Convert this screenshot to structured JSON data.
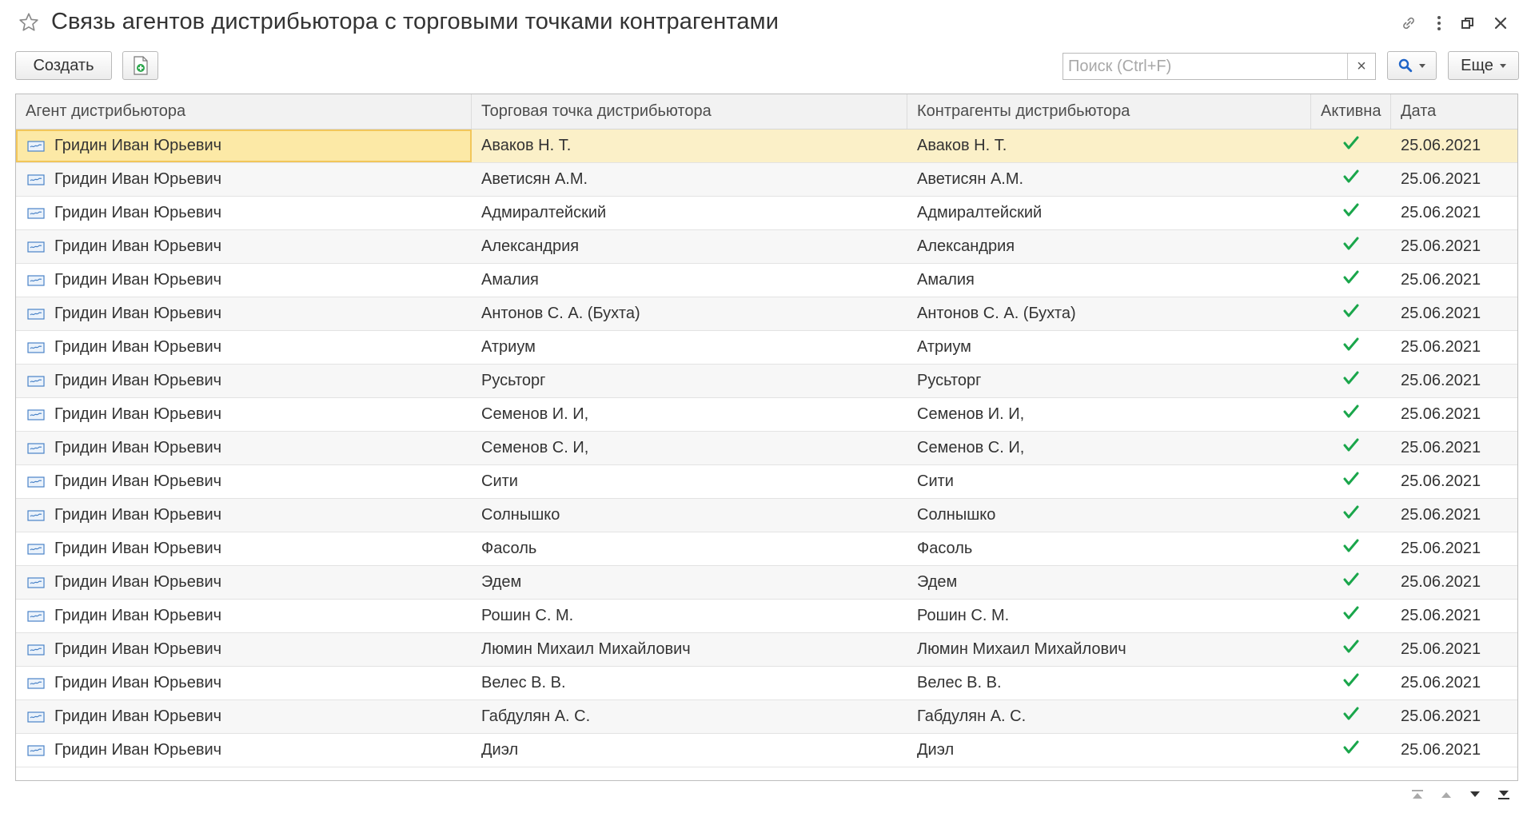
{
  "window": {
    "title": "Связь агентов дистрибьютора с торговыми точками контрагентами",
    "icons": [
      "star-icon",
      "link-icon",
      "more-vert-icon",
      "restore-icon",
      "close-icon"
    ]
  },
  "toolbar": {
    "create_label": "Создать",
    "copy_icon": "add-document-icon",
    "search_placeholder": "Поиск (Ctrl+F)",
    "search_value": "",
    "clear_label": "×",
    "more_label": "Еще"
  },
  "table": {
    "columns": [
      "Агент дистрибьютора",
      "Торговая точка дистрибьютора",
      "Контрагенты дистрибьютора",
      "Активна",
      "Дата"
    ],
    "rows": [
      {
        "agent": "Гридин Иван Юрьевич",
        "point": "Аваков Н. Т.",
        "contractor": "Аваков Н. Т.",
        "active": true,
        "date": "25.06.2021"
      },
      {
        "agent": "Гридин Иван Юрьевич",
        "point": "Аветисян А.М.",
        "contractor": "Аветисян А.М.",
        "active": true,
        "date": "25.06.2021"
      },
      {
        "agent": "Гридин Иван Юрьевич",
        "point": "Адмиралтейский",
        "contractor": "Адмиралтейский",
        "active": true,
        "date": "25.06.2021"
      },
      {
        "agent": "Гридин Иван Юрьевич",
        "point": "Александрия",
        "contractor": "Александрия",
        "active": true,
        "date": "25.06.2021"
      },
      {
        "agent": "Гридин Иван Юрьевич",
        "point": "Амалия",
        "contractor": "Амалия",
        "active": true,
        "date": "25.06.2021"
      },
      {
        "agent": "Гридин Иван Юрьевич",
        "point": "Антонов С. А. (Бухта)",
        "contractor": "Антонов С. А. (Бухта)",
        "active": true,
        "date": "25.06.2021"
      },
      {
        "agent": "Гридин Иван Юрьевич",
        "point": "Атриум",
        "contractor": "Атриум",
        "active": true,
        "date": "25.06.2021"
      },
      {
        "agent": "Гридин Иван Юрьевич",
        "point": "Русьторг",
        "contractor": "Русьторг",
        "active": true,
        "date": "25.06.2021"
      },
      {
        "agent": "Гридин Иван Юрьевич",
        "point": "Семенов И. И,",
        "contractor": "Семенов И. И,",
        "active": true,
        "date": "25.06.2021"
      },
      {
        "agent": "Гридин Иван Юрьевич",
        "point": "Семенов С. И,",
        "contractor": "Семенов С. И,",
        "active": true,
        "date": "25.06.2021"
      },
      {
        "agent": "Гридин Иван Юрьевич",
        "point": "Сити",
        "contractor": "Сити",
        "active": true,
        "date": "25.06.2021"
      },
      {
        "agent": "Гридин Иван Юрьевич",
        "point": "Солнышко",
        "contractor": "Солнышко",
        "active": true,
        "date": "25.06.2021"
      },
      {
        "agent": "Гридин Иван Юрьевич",
        "point": "Фасоль",
        "contractor": "Фасоль",
        "active": true,
        "date": "25.06.2021"
      },
      {
        "agent": "Гридин Иван Юрьевич",
        "point": "Эдем",
        "contractor": "Эдем",
        "active": true,
        "date": "25.06.2021"
      },
      {
        "agent": "Гридин Иван Юрьевич",
        "point": "Рошин С. М.",
        "contractor": "Рошин С. М.",
        "active": true,
        "date": "25.06.2021"
      },
      {
        "agent": "Гридин Иван Юрьевич",
        "point": "Люмин Михаил Михайлович",
        "contractor": "Люмин Михаил Михайлович",
        "active": true,
        "date": "25.06.2021"
      },
      {
        "agent": "Гридин Иван Юрьевич",
        "point": "Велес В. В.",
        "contractor": "Велес В. В.",
        "active": true,
        "date": "25.06.2021"
      },
      {
        "agent": "Гридин Иван Юрьевич",
        "point": "Габдулян А. С.",
        "contractor": "Габдулян А. С.",
        "active": true,
        "date": "25.06.2021"
      },
      {
        "agent": "Гридин Иван Юрьевич",
        "point": "Диэл",
        "contractor": "Диэл",
        "active": true,
        "date": "25.06.2021"
      }
    ],
    "selected_row": 0
  },
  "colors": {
    "check": "#1aa64b",
    "selection": "#fbf0c8",
    "selection_border": "#f2c65a",
    "header_bg": "#f2f2f2",
    "search_icon": "#1e64c8"
  },
  "pager": [
    "first-page-icon",
    "prev-page-icon",
    "next-page-icon",
    "last-page-icon"
  ]
}
